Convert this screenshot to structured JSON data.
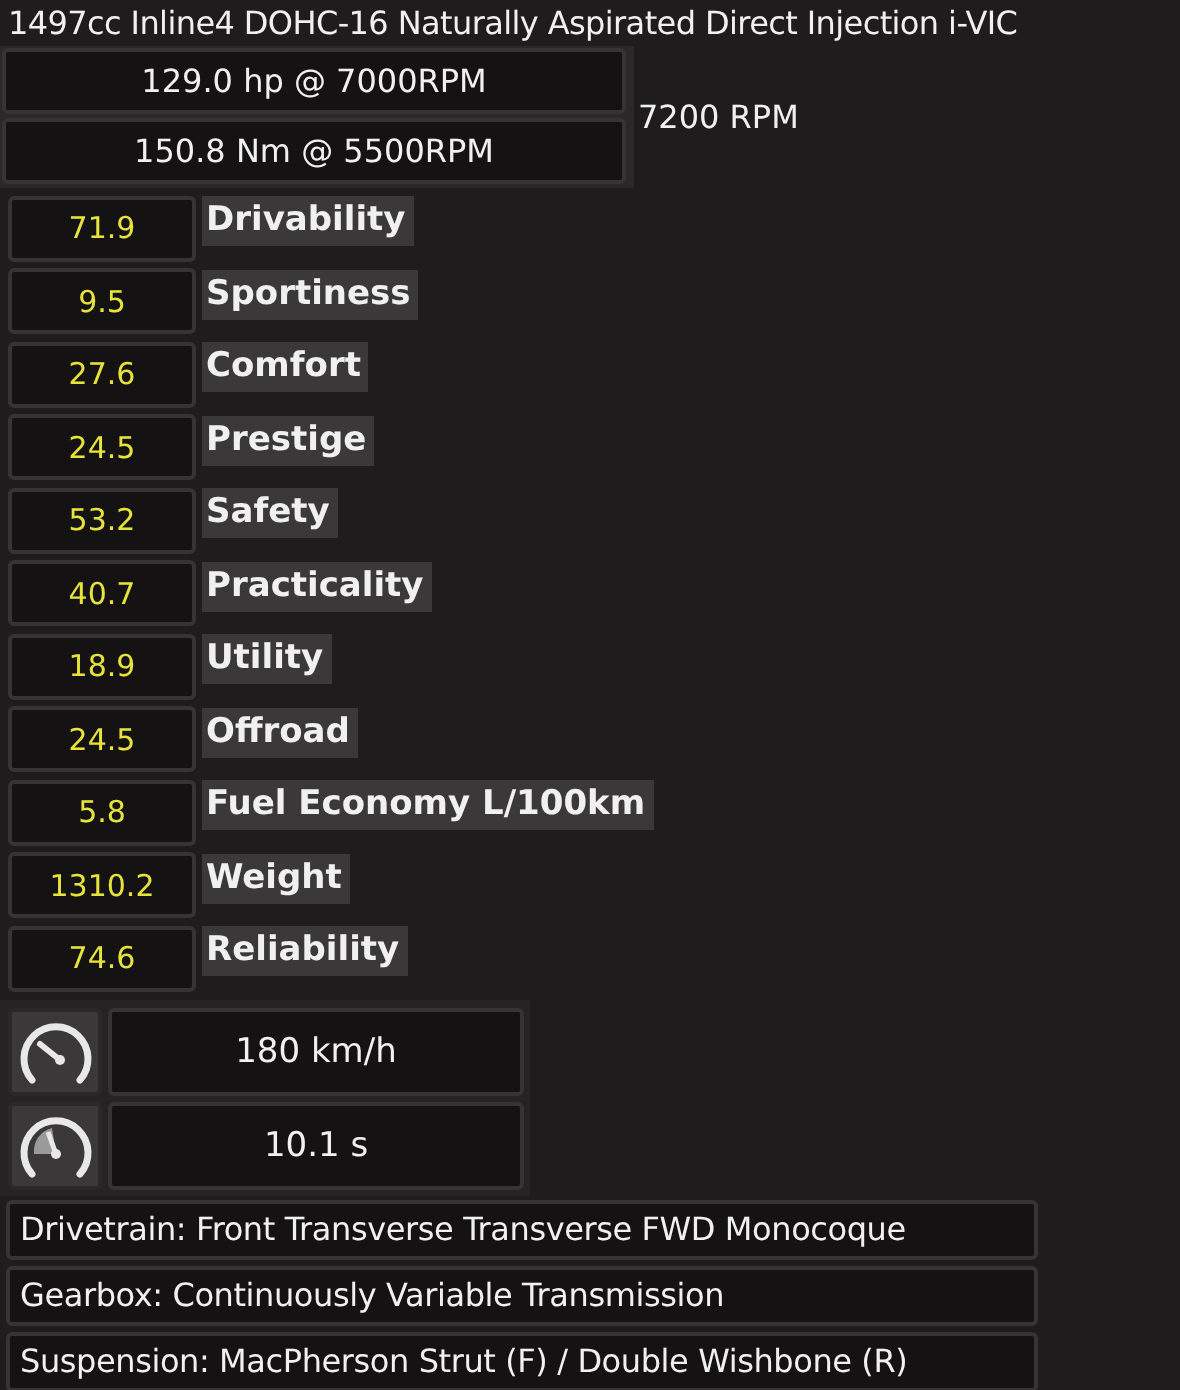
{
  "engine": {
    "title": "1497cc Inline4 DOHC-16 Naturally Aspirated Direct Injection i-VIC",
    "power": "129.0 hp @ 7000RPM",
    "torque": "150.8 Nm @ 5500RPM",
    "redline": "7200 RPM"
  },
  "stats": [
    {
      "value": "71.9",
      "label": "Drivability"
    },
    {
      "value": "9.5",
      "label": "Sportiness"
    },
    {
      "value": "27.6",
      "label": "Comfort"
    },
    {
      "value": "24.5",
      "label": "Prestige"
    },
    {
      "value": "53.2",
      "label": "Safety"
    },
    {
      "value": "40.7",
      "label": "Practicality"
    },
    {
      "value": "18.9",
      "label": "Utility"
    },
    {
      "value": "24.5",
      "label": "Offroad"
    },
    {
      "value": "5.8",
      "label": "Fuel Economy L/100km"
    },
    {
      "value": "1310.2",
      "label": "Weight"
    },
    {
      "value": "74.6",
      "label": "Reliability"
    }
  ],
  "performance": [
    {
      "kind": "top_speed",
      "value": "180 km/h"
    },
    {
      "kind": "acceleration",
      "value": "10.1 s"
    }
  ],
  "details": [
    "Drivetrain: Front Transverse Transverse FWD Monocoque",
    "Gearbox: Continuously Variable Transmission",
    "Suspension: MacPherson Strut (F) / Double Wishbone (R)"
  ]
}
